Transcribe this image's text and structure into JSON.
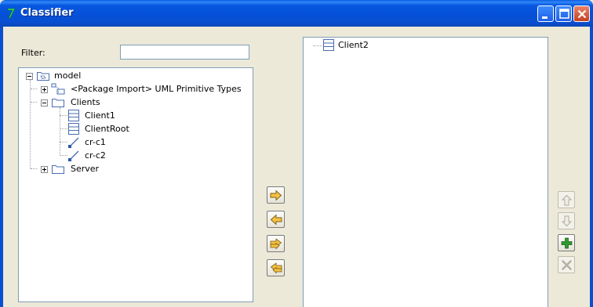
{
  "window": {
    "title": "Classifier"
  },
  "filter": {
    "label": "Filter:",
    "value": "",
    "placeholder": ""
  },
  "source_tree": {
    "root": {
      "label": "model",
      "expanded": true
    },
    "package_import": {
      "label": "<Package Import> UML Primitive Types",
      "expanded": false
    },
    "clients": {
      "label": "Clients",
      "expanded": true
    },
    "client1": {
      "label": "Client1"
    },
    "client_root": {
      "label": "ClientRoot"
    },
    "cr_c1": {
      "label": "cr-c1"
    },
    "cr_c2": {
      "label": "cr-c2"
    },
    "server": {
      "label": "Server",
      "expanded": false
    }
  },
  "selected_tree": {
    "items": [
      {
        "label": "Client2"
      }
    ]
  },
  "transfer_buttons": [
    {
      "name": "add-selected",
      "icon": "arrow-right-icon",
      "enabled": true
    },
    {
      "name": "remove-selected",
      "icon": "arrow-left-icon",
      "enabled": true
    },
    {
      "name": "add-all",
      "icon": "double-arrow-right-icon",
      "enabled": true
    },
    {
      "name": "remove-all",
      "icon": "double-arrow-left-icon",
      "enabled": true
    }
  ],
  "order_buttons": [
    {
      "name": "move-up",
      "icon": "arrow-up-icon",
      "enabled": false
    },
    {
      "name": "move-down",
      "icon": "arrow-down-icon",
      "enabled": false
    },
    {
      "name": "add",
      "icon": "plus-icon",
      "enabled": true
    },
    {
      "name": "delete",
      "icon": "x-icon",
      "enabled": false
    }
  ],
  "colors": {
    "titlebar": "#0550d7",
    "background": "#ece9d8",
    "arrow_fill": "#f5c242",
    "add_green": "#2f9a2f"
  }
}
